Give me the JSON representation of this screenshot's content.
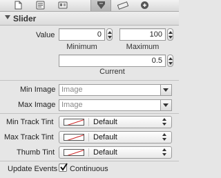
{
  "toolbar": {
    "tabs": [
      {
        "icon": "file-icon"
      },
      {
        "icon": "quick-help-icon"
      },
      {
        "icon": "identity-icon"
      },
      {
        "icon": "attributes-icon",
        "selected": true
      },
      {
        "icon": "size-ruler-icon"
      },
      {
        "icon": "connections-icon"
      }
    ]
  },
  "section": {
    "title": "Slider"
  },
  "value": {
    "label": "Value",
    "minimum": {
      "value": "0",
      "caption": "Minimum"
    },
    "maximum": {
      "value": "100",
      "caption": "Maximum"
    },
    "current": {
      "value": "0.5",
      "caption": "Current"
    }
  },
  "images": {
    "min": {
      "label": "Min Image",
      "placeholder": "Image"
    },
    "max": {
      "label": "Max Image",
      "placeholder": "Image"
    }
  },
  "tints": {
    "min_track": {
      "label": "Min Track Tint",
      "value": "Default"
    },
    "max_track": {
      "label": "Max Track Tint",
      "value": "Default"
    },
    "thumb": {
      "label": "Thumb Tint",
      "value": "Default"
    }
  },
  "events": {
    "label": "Update Events",
    "checkbox_label": "Continuous",
    "checked": true
  },
  "colors": {
    "swatch_slash": "#cc2222"
  }
}
